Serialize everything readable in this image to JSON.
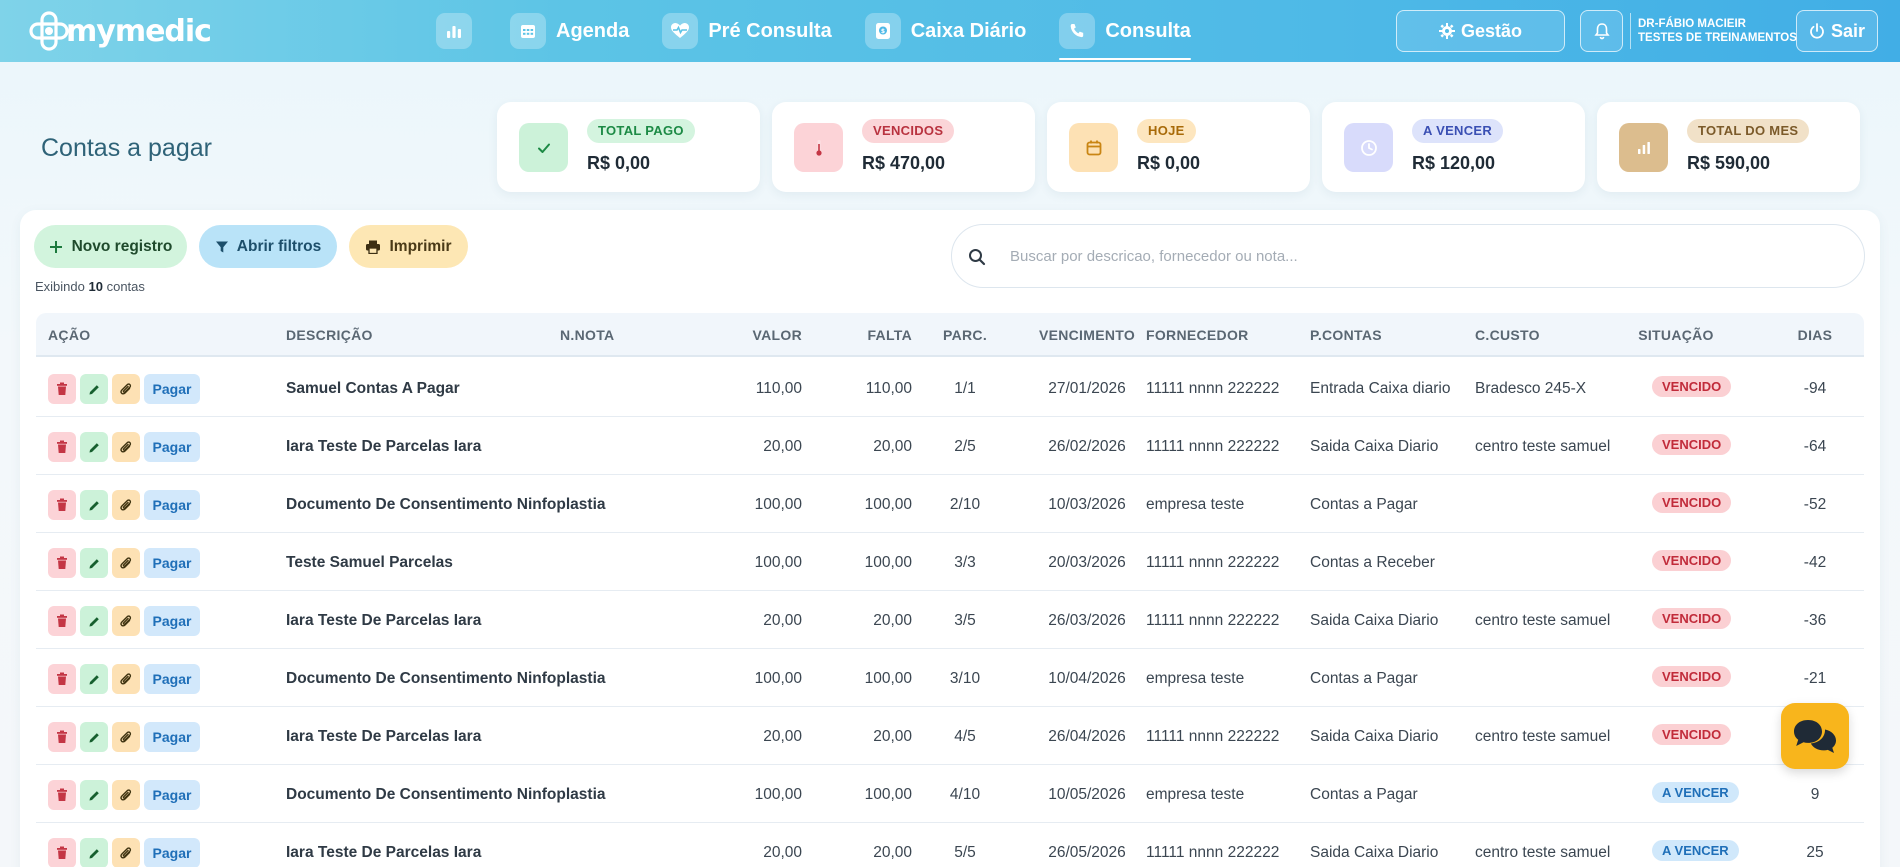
{
  "app": {
    "logo_text": "mymedic"
  },
  "nav": {
    "items": [
      {
        "label": "",
        "icon": "bar-chart-icon"
      },
      {
        "label": "Agenda",
        "icon": "calendar-icon"
      },
      {
        "label": "Pré Consulta",
        "icon": "heart-pulse-icon"
      },
      {
        "label": "Caixa Diário",
        "icon": "money-icon"
      },
      {
        "label": "Consulta",
        "icon": "phone-icon",
        "active": true
      }
    ]
  },
  "header": {
    "gestao_label": "Gestão",
    "user_name": "DR-FÁBIO MACIEIR",
    "user_org": "TESTES DE TREINAMENTOS",
    "sair_label": "Sair"
  },
  "page": {
    "title": "Contas a pagar"
  },
  "summary": [
    {
      "label": "TOTAL PAGO",
      "value": "R$ 0,00",
      "icon": "check-icon",
      "label_bg": "#d4f4df",
      "label_color": "#1c8a45",
      "icon_bg": "#ccf2d9",
      "icon_color": "#1c8a45"
    },
    {
      "label": "VENCIDOS",
      "value": "R$ 470,00",
      "icon": "thermometer-icon",
      "label_bg": "#fbd5d8",
      "label_color": "#b8323f",
      "icon_bg": "#fcd3d7",
      "icon_color": "#c43645"
    },
    {
      "label": "HOJE",
      "value": "R$ 0,00",
      "icon": "calendar-icon",
      "label_bg": "#fde6bf",
      "label_color": "#a86a08",
      "icon_bg": "#fde1b4",
      "icon_color": "#c98513"
    },
    {
      "label": "A VENCER",
      "value": "R$ 120,00",
      "icon": "clock-icon",
      "label_bg": "#dde3fb",
      "label_color": "#3a4fb3",
      "icon_bg": "#d8dbfb",
      "icon_color": "#ffffff"
    },
    {
      "label": "TOTAL DO MES",
      "value": "R$ 590,00",
      "icon": "bar-chart-icon",
      "label_bg": "#f1e1c8",
      "label_color": "#7b5a2a",
      "icon_bg": "#dcbd8e",
      "icon_color": "#ffffff"
    }
  ],
  "actions": {
    "novo_label": "Novo registro",
    "filtros_label": "Abrir filtros",
    "imprimir_label": "Imprimir",
    "count_prefix": "Exibindo",
    "count": "10",
    "count_suffix": "contas"
  },
  "search": {
    "placeholder": "Buscar por descricao, fornecedor ou nota..."
  },
  "table": {
    "headers": {
      "acao": "AÇÃO",
      "descricao": "DESCRIÇÃO",
      "nnota": "N.NOTA",
      "valor": "VALOR",
      "falta": "FALTA",
      "parc": "PARC.",
      "vencimento": "VENCIMENTO",
      "fornecedor": "FORNECEDOR",
      "pcontas": "P.CONTAS",
      "ccusto": "C.CUSTO",
      "situacao": "SITUAÇÃO",
      "dias": "DIAS"
    },
    "pay_label": "Pagar",
    "rows": [
      {
        "descricao": "Samuel Contas A Pagar",
        "nnota": "",
        "valor": "110,00",
        "falta": "110,00",
        "parc": "1/1",
        "vencimento": "27/01/2026",
        "fornecedor": "11111 nnnn 222222",
        "pcontas": "Entrada Caixa diario",
        "ccusto": "Bradesco 245-X",
        "situacao": "VENCIDO",
        "dias": "-94"
      },
      {
        "descricao": "Iara Teste De Parcelas Iara",
        "nnota": "",
        "valor": "20,00",
        "falta": "20,00",
        "parc": "2/5",
        "vencimento": "26/02/2026",
        "fornecedor": "11111 nnnn 222222",
        "pcontas": "Saida Caixa Diario",
        "ccusto": "centro teste samuel",
        "situacao": "VENCIDO",
        "dias": "-64"
      },
      {
        "descricao": "Documento De Consentimento Ninfoplastia",
        "nnota": "",
        "valor": "100,00",
        "falta": "100,00",
        "parc": "2/10",
        "vencimento": "10/03/2026",
        "fornecedor": "empresa teste",
        "pcontas": "Contas a Pagar",
        "ccusto": "",
        "situacao": "VENCIDO",
        "dias": "-52"
      },
      {
        "descricao": "Teste Samuel Parcelas",
        "nnota": "",
        "valor": "100,00",
        "falta": "100,00",
        "parc": "3/3",
        "vencimento": "20/03/2026",
        "fornecedor": "11111 nnnn 222222",
        "pcontas": "Contas a Receber",
        "ccusto": "",
        "situacao": "VENCIDO",
        "dias": "-42"
      },
      {
        "descricao": "Iara Teste De Parcelas Iara",
        "nnota": "",
        "valor": "20,00",
        "falta": "20,00",
        "parc": "3/5",
        "vencimento": "26/03/2026",
        "fornecedor": "11111 nnnn 222222",
        "pcontas": "Saida Caixa Diario",
        "ccusto": "centro teste samuel",
        "situacao": "VENCIDO",
        "dias": "-36"
      },
      {
        "descricao": "Documento De Consentimento Ninfoplastia",
        "nnota": "",
        "valor": "100,00",
        "falta": "100,00",
        "parc": "3/10",
        "vencimento": "10/04/2026",
        "fornecedor": "empresa teste",
        "pcontas": "Contas a Pagar",
        "ccusto": "",
        "situacao": "VENCIDO",
        "dias": "-21"
      },
      {
        "descricao": "Iara Teste De Parcelas Iara",
        "nnota": "",
        "valor": "20,00",
        "falta": "20,00",
        "parc": "4/5",
        "vencimento": "26/04/2026",
        "fornecedor": "11111 nnnn 222222",
        "pcontas": "Saida Caixa Diario",
        "ccusto": "centro teste samuel",
        "situacao": "VENCIDO",
        "dias": ""
      },
      {
        "descricao": "Documento De Consentimento Ninfoplastia",
        "nnota": "",
        "valor": "100,00",
        "falta": "100,00",
        "parc": "4/10",
        "vencimento": "10/05/2026",
        "fornecedor": "empresa teste",
        "pcontas": "Contas a Pagar",
        "ccusto": "",
        "situacao": "A VENCER",
        "dias": "9"
      },
      {
        "descricao": "Iara Teste De Parcelas Iara",
        "nnota": "",
        "valor": "20,00",
        "falta": "20,00",
        "parc": "5/5",
        "vencimento": "26/05/2026",
        "fornecedor": "11111 nnnn 222222",
        "pcontas": "Saida Caixa Diario",
        "ccusto": "centro teste samuel",
        "situacao": "A VENCER",
        "dias": "25"
      }
    ]
  },
  "colors": {
    "topbar_start": "#7fd3e9",
    "topbar_end": "#41aee6",
    "chat_button": "#f8b51c"
  }
}
